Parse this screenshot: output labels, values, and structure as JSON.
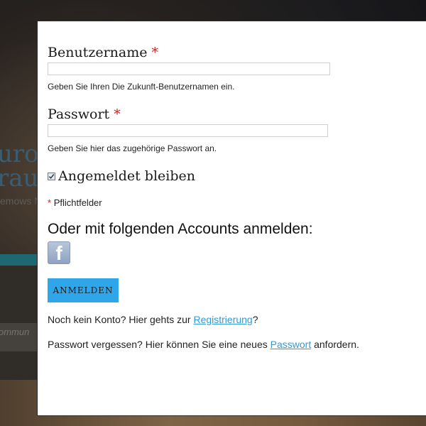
{
  "background": {
    "site_title_line1": "uro-",
    "site_title_line2": "rau",
    "site_subtitle": "emows N",
    "community_text": "ommun"
  },
  "form": {
    "username": {
      "label": "Benutzername",
      "required_marker": "*",
      "value": "",
      "hint": "Geben Sie Ihren Die Zukunft-Benutzernamen ein."
    },
    "password": {
      "label": "Passwort",
      "required_marker": "*",
      "value": "",
      "hint": "Geben Sie hier das zugehörige Passwort an."
    },
    "remember": {
      "label": "Angemeldet bleiben",
      "checked": true
    },
    "required_note": {
      "marker": "*",
      "text": "Pflichtfelder"
    },
    "oauth": {
      "heading": "Oder mit folgenden Accounts anmelden:",
      "facebook_glyph": "f"
    },
    "submit_label": "ANMELDEN",
    "register": {
      "prefix": "Noch kein Konto? Hier gehts zur ",
      "link": "Registrierung",
      "suffix": "?"
    },
    "forgot": {
      "prefix": "Passwort vergessen? Hier können Sie eine neues ",
      "link": "Passwort",
      "suffix": " anfordern."
    }
  },
  "colors": {
    "required": "#cc1e1e",
    "button": "#2fa6ea",
    "link": "#2f9bd7",
    "band": "#2ea0b0"
  }
}
